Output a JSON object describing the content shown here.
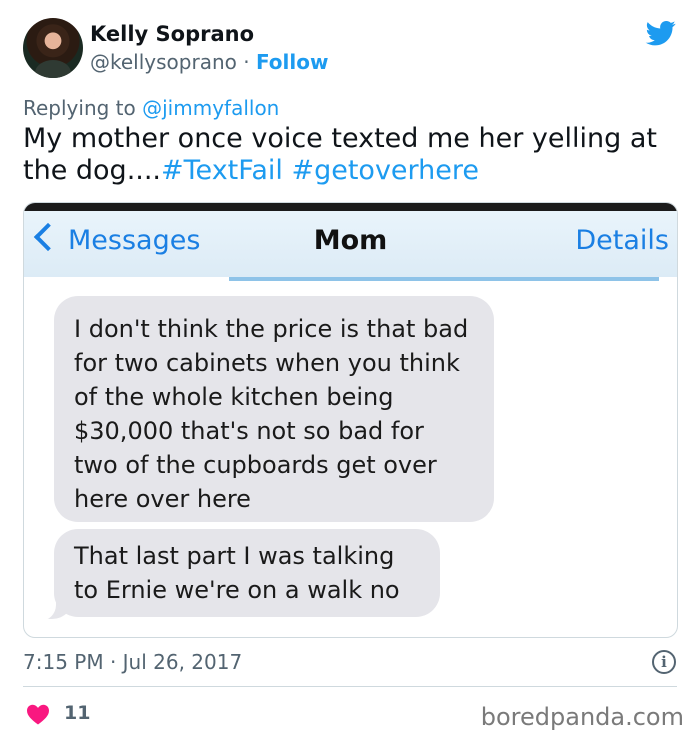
{
  "user": {
    "name": "Kelly Soprano",
    "handle": "@kellysoprano",
    "separator": "·",
    "follow_label": "Follow"
  },
  "reply": {
    "prefix": "Replying to",
    "mention": "@jimmyfallon"
  },
  "tweet": {
    "text_part1": "My mother once voice texted me her yelling at the dog....",
    "hashtag1": "#TextFail",
    "hashtag2": "#getoverhere"
  },
  "screenshot": {
    "back_label": "Messages",
    "title": "Mom",
    "details_label": "Details",
    "message1": " I don't think the price is that bad for two cabinets when you think of the whole kitchen being $30,000 that's not so bad for two of the cupboards get over here over here",
    "message2": "That last part I was talking to Ernie we're on a walk no"
  },
  "meta": {
    "timestamp": "7:15 PM · Jul 26, 2017",
    "likes": "11",
    "watermark": "boredpanda.com"
  },
  "colors": {
    "accent": "#1d9bf0",
    "heart": "#f91880",
    "ios_blue": "#1a7fe3",
    "bubble": "#e5e5ea"
  },
  "icons": [
    "twitter-bird-icon",
    "chevron-left-icon",
    "info-icon",
    "heart-icon"
  ]
}
